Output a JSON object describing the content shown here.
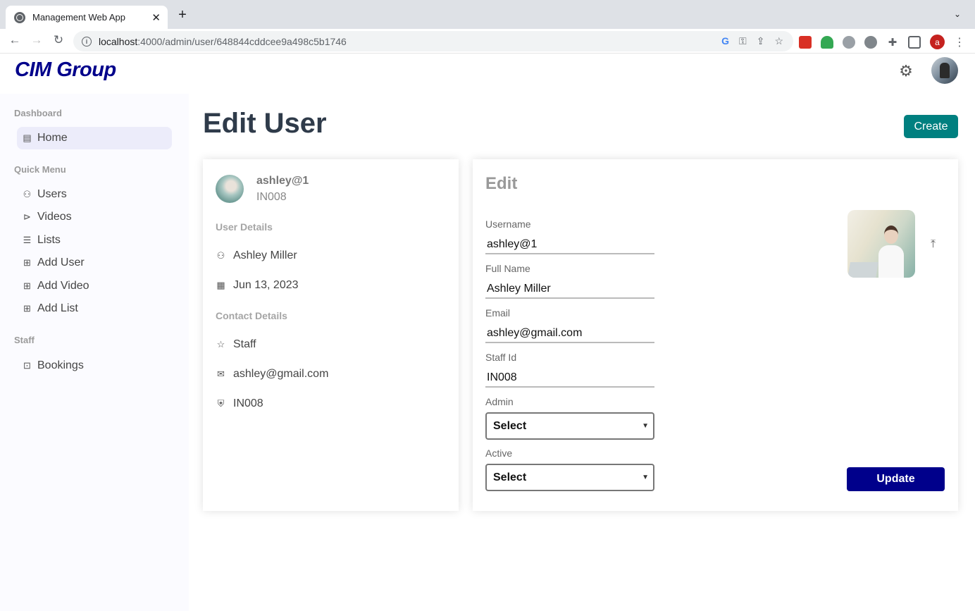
{
  "browser": {
    "tab_title": "Management Web App",
    "tab_close": "✕",
    "new_tab": "+",
    "tab_menu": "⌄",
    "url_host": "localhost",
    "url_path": ":4000/admin/user/648844cddcee9a498c5b1746",
    "profile_initial": "a"
  },
  "app": {
    "logo": "CIM Group"
  },
  "sidebar": {
    "sections": [
      {
        "title": "Dashboard"
      },
      {
        "title": "Quick Menu"
      },
      {
        "title": "Staff"
      }
    ],
    "items": [
      {
        "label": "Home",
        "icon": "home-icon"
      },
      {
        "label": "Users",
        "icon": "user-icon"
      },
      {
        "label": "Videos",
        "icon": "play-icon"
      },
      {
        "label": "Lists",
        "icon": "list-icon"
      },
      {
        "label": "Add User",
        "icon": "add-box-icon"
      },
      {
        "label": "Add Video",
        "icon": "add-box-icon"
      },
      {
        "label": "Add List",
        "icon": "add-box-icon"
      },
      {
        "label": "Bookings",
        "icon": "briefcase-icon"
      }
    ]
  },
  "page": {
    "title": "Edit User",
    "create_label": "Create"
  },
  "show": {
    "username": "ashley@1",
    "staff_id": "IN008",
    "user_details_title": "User Details",
    "full_name": "Ashley Miller",
    "date": "Jun 13, 2023",
    "contact_details_title": "Contact Details",
    "role": "Staff",
    "email": "ashley@gmail.com",
    "staff_id_row": "IN008"
  },
  "edit": {
    "title": "Edit",
    "fields": {
      "username": {
        "label": "Username",
        "value": "ashley@1"
      },
      "full_name": {
        "label": "Full Name",
        "value": "Ashley Miller"
      },
      "email": {
        "label": "Email",
        "value": "ashley@gmail.com"
      },
      "staff_id": {
        "label": "Staff Id",
        "value": "IN008"
      },
      "admin": {
        "label": "Admin",
        "value": "Select"
      },
      "active": {
        "label": "Active",
        "value": "Select"
      }
    },
    "update_label": "Update"
  },
  "colors": {
    "logo": "#00008b",
    "create_button": "#008080",
    "update_button": "#00008b",
    "active_nav": "#ececfa"
  }
}
